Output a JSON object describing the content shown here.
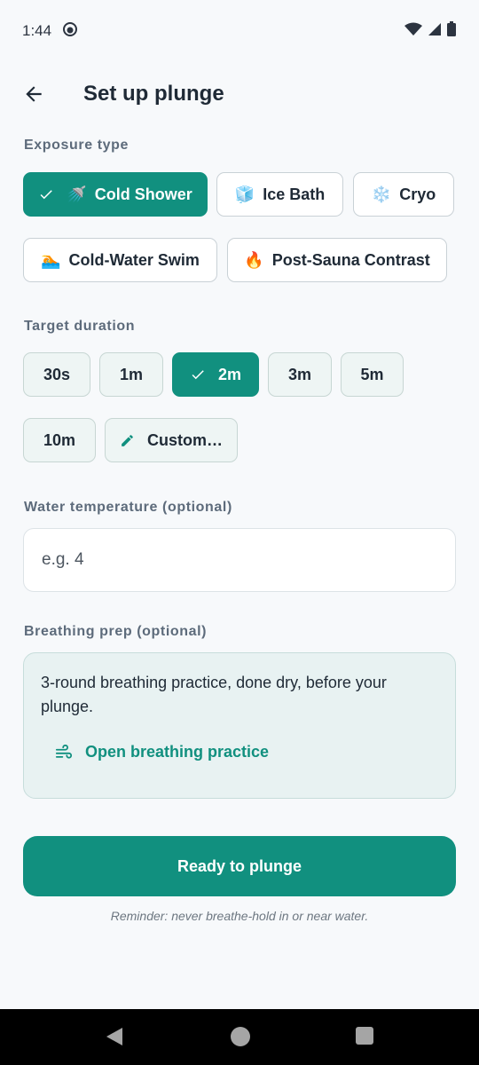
{
  "status_bar": {
    "time": "1:44"
  },
  "header": {
    "title": "Set up plunge"
  },
  "exposure": {
    "label": "Exposure type",
    "options": [
      {
        "label": "Cold Shower",
        "icon": "🚿",
        "selected": true
      },
      {
        "label": "Ice Bath",
        "icon": "🧊",
        "selected": false
      },
      {
        "label": "Cryo",
        "icon": "❄️",
        "selected": false
      },
      {
        "label": "Cold-Water Swim",
        "icon": "🏊",
        "selected": false
      },
      {
        "label": "Post-Sauna Contrast",
        "icon": "🔥",
        "selected": false
      }
    ]
  },
  "duration": {
    "label": "Target duration",
    "options": [
      {
        "label": "30s",
        "selected": false
      },
      {
        "label": "1m",
        "selected": false
      },
      {
        "label": "2m",
        "selected": true
      },
      {
        "label": "3m",
        "selected": false
      },
      {
        "label": "5m",
        "selected": false
      },
      {
        "label": "10m",
        "selected": false
      },
      {
        "label": "Custom…",
        "selected": false
      }
    ]
  },
  "temperature": {
    "label": "Water temperature (optional)",
    "value": "",
    "placeholder": "e.g. 4"
  },
  "breathing": {
    "label": "Breathing prep (optional)",
    "description": "3-round breathing practice, done dry, before your plunge.",
    "link_label": "Open breathing practice"
  },
  "primary_button": {
    "label": "Ready to plunge"
  },
  "reminder": "Reminder: never breathe-hold in or near water.",
  "colors": {
    "accent": "#11907f",
    "background": "#f7f9fb"
  }
}
